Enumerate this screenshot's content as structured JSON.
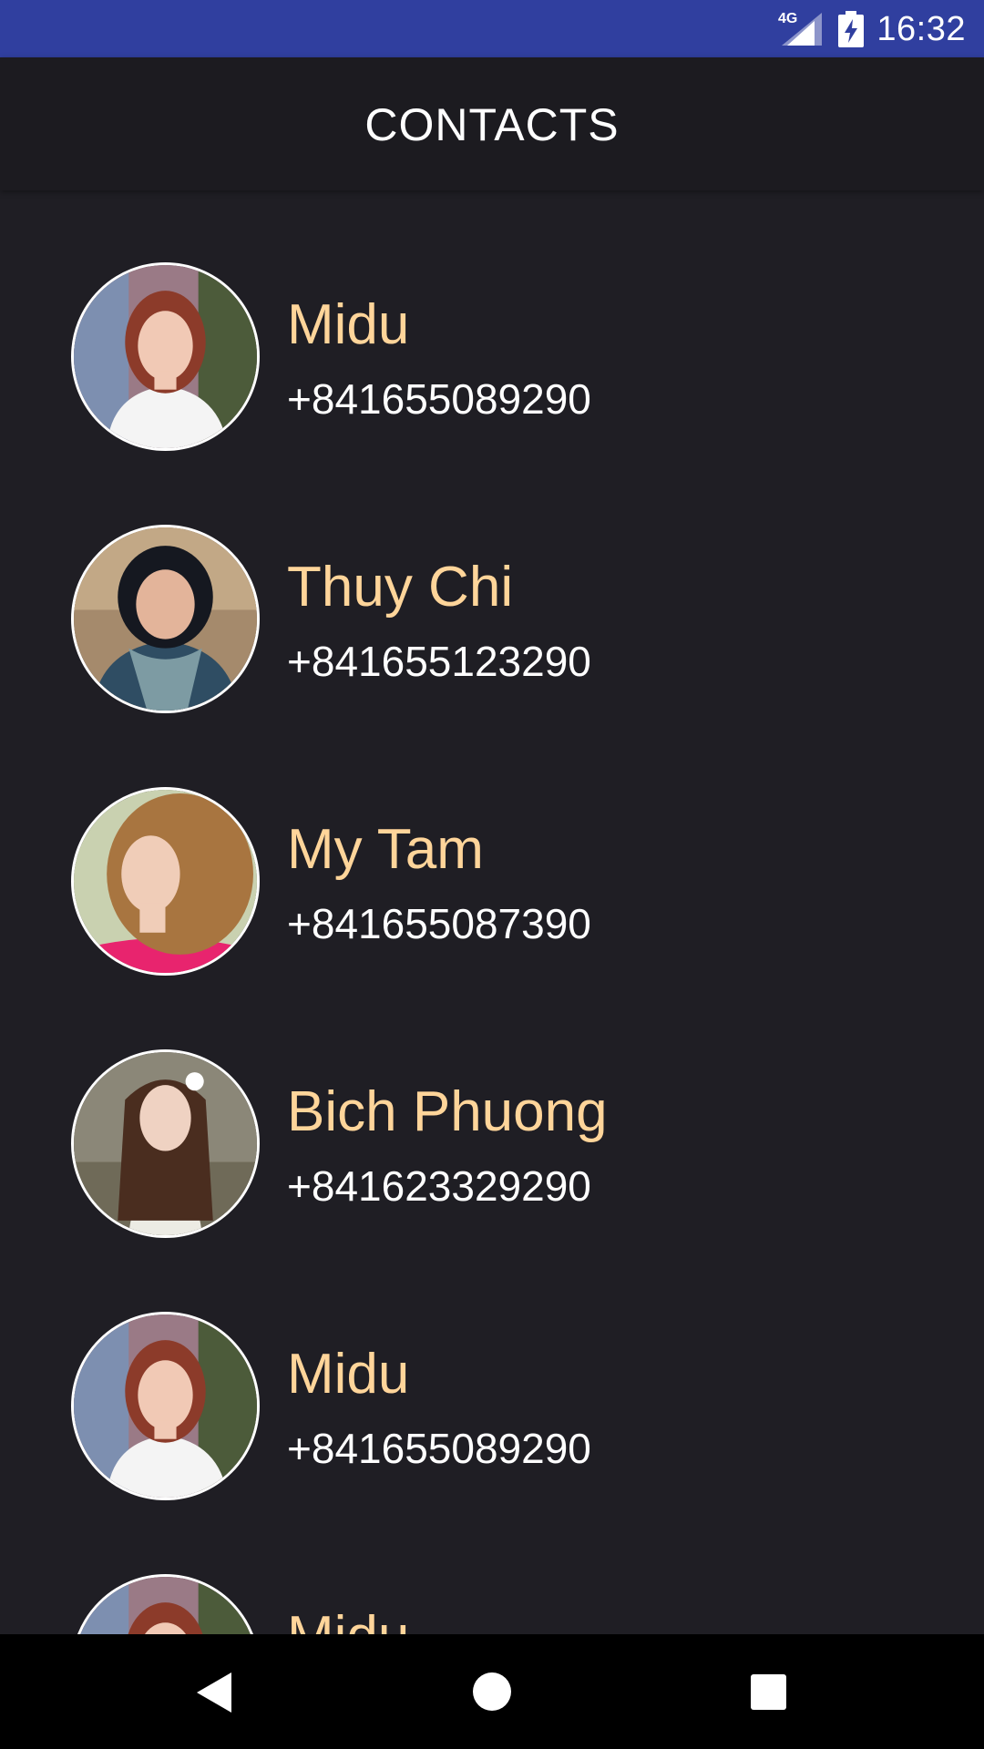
{
  "status_bar": {
    "network": "4G",
    "time": "16:32",
    "icons": [
      "signal-icon",
      "battery-charging-icon"
    ],
    "bg_color": "#303f9f"
  },
  "app_bar": {
    "title": "CONTACTS"
  },
  "contacts": [
    {
      "name": "Midu",
      "phone": "+841655089290",
      "avatar_icon": "avatar-photo"
    },
    {
      "name": "Thuy Chi",
      "phone": "+841655123290",
      "avatar_icon": "avatar-photo"
    },
    {
      "name": "My Tam",
      "phone": "+841655087390",
      "avatar_icon": "avatar-photo"
    },
    {
      "name": "Bich Phuong",
      "phone": "+841623329290",
      "avatar_icon": "avatar-photo"
    },
    {
      "name": "Midu",
      "phone": "+841655089290",
      "avatar_icon": "avatar-photo"
    },
    {
      "name": "Midu",
      "phone": "",
      "avatar_icon": "avatar-photo"
    }
  ],
  "nav_bar": {
    "icons": [
      "back-icon",
      "home-icon",
      "recents-icon"
    ]
  },
  "colors": {
    "background": "#1f1e24",
    "app_bar": "#1c1b20",
    "name_text": "#ffd59a",
    "phone_text": "#ffffff",
    "nav_bar": "#000000"
  }
}
